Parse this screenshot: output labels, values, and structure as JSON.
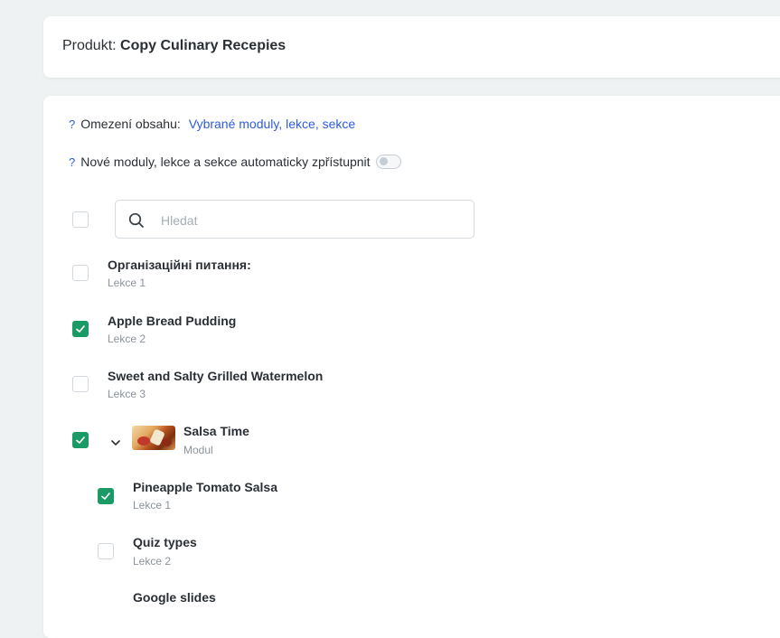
{
  "header": {
    "prefix": "Produkt: ",
    "product_name": "Copy Culinary Recepies"
  },
  "settings": {
    "restriction_label": "Omezení obsahu:",
    "restriction_value": "Vybrané moduly, lekce, sekce",
    "auto_unlock_label": "Nové moduly, lekce a sekce automaticky zpřístupnit",
    "auto_unlock_enabled": false,
    "help_glyph": "?"
  },
  "search": {
    "placeholder": "Hledat",
    "value": ""
  },
  "items": [
    {
      "title": "Організаційні питання:",
      "subtitle": "Lekce 1",
      "checked": false
    },
    {
      "title": "Apple Bread Pudding",
      "subtitle": "Lekce 2",
      "checked": true
    },
    {
      "title": "Sweet and Salty Grilled Watermelon",
      "subtitle": "Lekce 3",
      "checked": true
    },
    {
      "title": "Salsa Time",
      "subtitle": "Modul",
      "checked": true,
      "expanded": true,
      "icon": "chevron-down-icon"
    },
    {
      "title": "Pineapple Tomato Salsa",
      "subtitle": "Lekce 1",
      "checked": true
    },
    {
      "title": "Quiz types",
      "subtitle": "Lekce 2",
      "checked": false
    },
    {
      "title": "Google slides",
      "subtitle": "",
      "checked": false
    }
  ],
  "colors": {
    "accent": "#2f5bd8",
    "checked": "#1a9a64",
    "background": "#eff2f3"
  }
}
